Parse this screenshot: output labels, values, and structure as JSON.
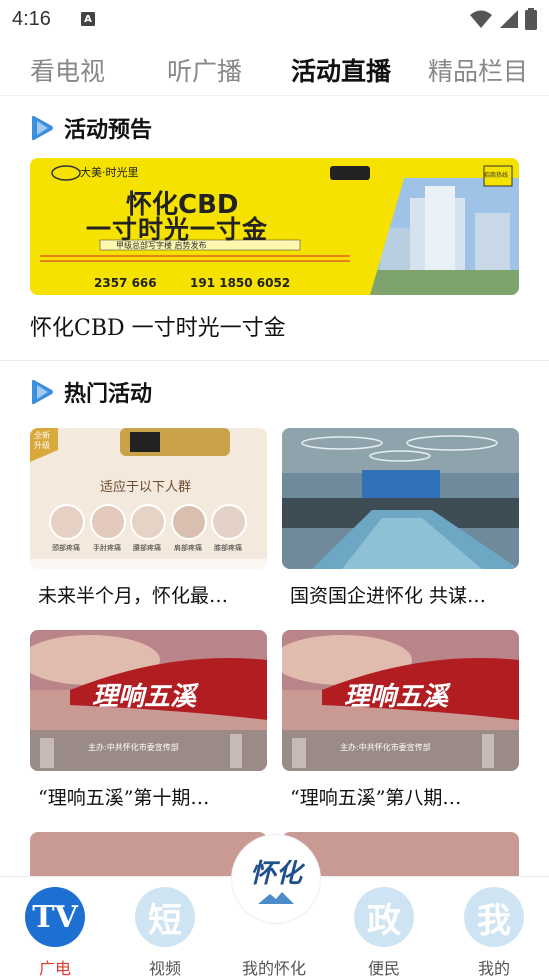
{
  "status_bar": {
    "time": "4:16",
    "notif_icon": "A"
  },
  "tabs": [
    {
      "label": "看电视",
      "active": false
    },
    {
      "label": "听广播",
      "active": false
    },
    {
      "label": "活动直播",
      "active": true
    },
    {
      "label": "精品栏目",
      "active": false
    }
  ],
  "preview_section": {
    "title": "活动预告",
    "banner": {
      "brand": "大美·时光里",
      "headline1": "怀化CBD",
      "headline2": "一寸时光一寸金",
      "strip": "甲级总部写字楼 启势发布",
      "phone1": "2357 666",
      "phone2": "191 1850 6052",
      "right_tag": "招商热线"
    },
    "caption": "怀化CBD 一寸时光一寸金"
  },
  "hot_section": {
    "title": "热门活动",
    "cards": [
      {
        "title": "未来半个月，怀化最…",
        "img_kind": "health"
      },
      {
        "title": "国资国企进怀化 共谋…",
        "img_kind": "meeting"
      },
      {
        "title": "“理响五溪”第十期…",
        "img_kind": "lixiang",
        "img_text": "理响五溪",
        "img_sub": "主办:中共怀化市委宣传部"
      },
      {
        "title": "“理响五溪”第八期…",
        "img_kind": "lixiang",
        "img_text": "理响五溪",
        "img_sub": "主办:中共怀化市委宣传部"
      }
    ],
    "health_card": {
      "badge": "全新升级",
      "heading": "适应于以下人群",
      "items": [
        "颈部疼痛",
        "手肘疼痛",
        "腰部疼痛",
        "肩部疼痛",
        "膝部疼痛"
      ]
    }
  },
  "bottom_nav": {
    "items": [
      {
        "label": "广电",
        "glyph": "TV",
        "active": true
      },
      {
        "label": "视频",
        "glyph": "短",
        "active": false
      },
      {
        "label": "我的怀化",
        "glyph": "怀化",
        "active": false
      },
      {
        "label": "便民",
        "glyph": "政",
        "active": false
      },
      {
        "label": "我的",
        "glyph": "我",
        "active": false
      }
    ]
  },
  "colors": {
    "accent": "#e03a2f",
    "tv_blue": "#1d6fd1",
    "pale_blue": "#cfe4f2"
  }
}
